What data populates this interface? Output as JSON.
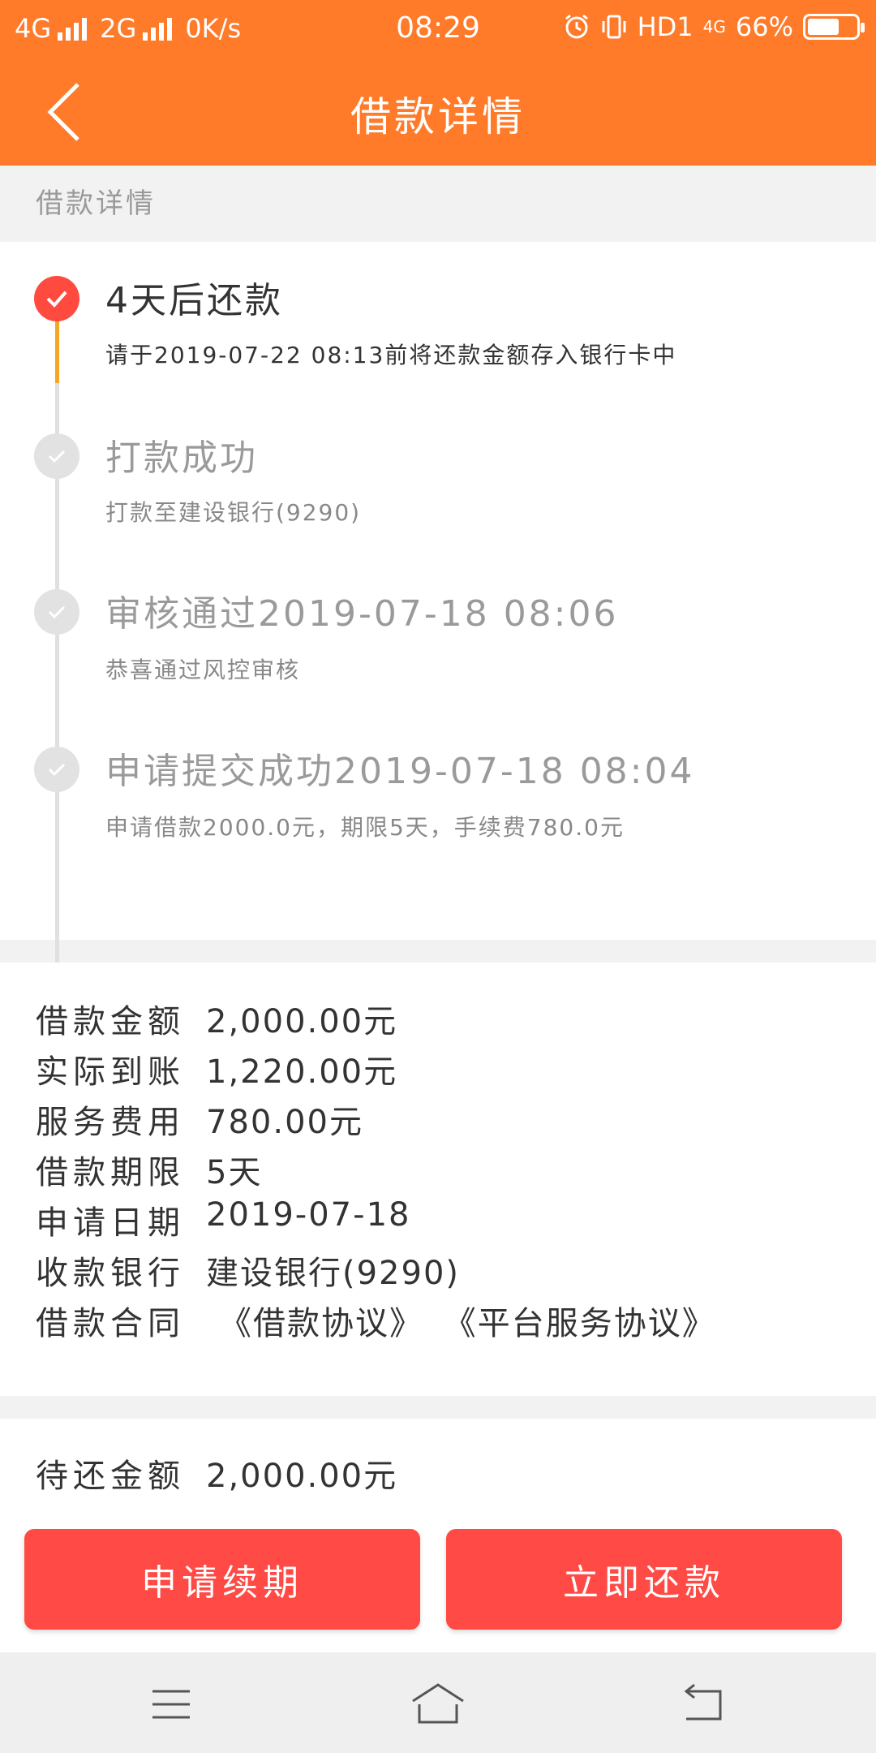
{
  "status_bar": {
    "net1": "4G",
    "net2": "2G",
    "speed": "0K/s",
    "time": "08:29",
    "hd": "HD1",
    "net3": "4G",
    "battery_text": "66%",
    "battery_level": 0.66
  },
  "nav": {
    "title": "借款详情"
  },
  "section": {
    "label": "借款详情"
  },
  "timeline": [
    {
      "title": "4天后还款",
      "desc": "请于2019-07-22 08:13前将还款金额存入银行卡中",
      "active": true
    },
    {
      "title": "打款成功",
      "desc": "打款至建设银行(9290)",
      "active": false
    },
    {
      "title": "审核通过2019-07-18 08:06",
      "desc": "恭喜通过风控审核",
      "active": false
    },
    {
      "title": "申请提交成功2019-07-18 08:04",
      "desc": "申请借款2000.0元，期限5天，手续费780.0元",
      "active": false
    }
  ],
  "details": {
    "loan_amount": {
      "label": "借款金额",
      "value": "2,000.00元"
    },
    "received": {
      "label": "实际到账",
      "value": "1,220.00元"
    },
    "service_fee": {
      "label": "服务费用",
      "value": "780.00元"
    },
    "term": {
      "label": "借款期限",
      "value": "5天"
    },
    "apply_date": {
      "label": "申请日期",
      "value": "2019-07-18"
    },
    "bank": {
      "label": "收款银行",
      "value": "建设银行(9290)"
    },
    "contract": {
      "label": "借款合同",
      "link1": "《借款协议》",
      "link2": "《平台服务协议》"
    }
  },
  "due": {
    "label": "待还金额",
    "value": "2,000.00元"
  },
  "buttons": {
    "renew": "申请续期",
    "repay": "立即还款"
  },
  "colors": {
    "brand": "#ff7a29",
    "accent": "#ff4a45",
    "progress": "#f5a623"
  }
}
